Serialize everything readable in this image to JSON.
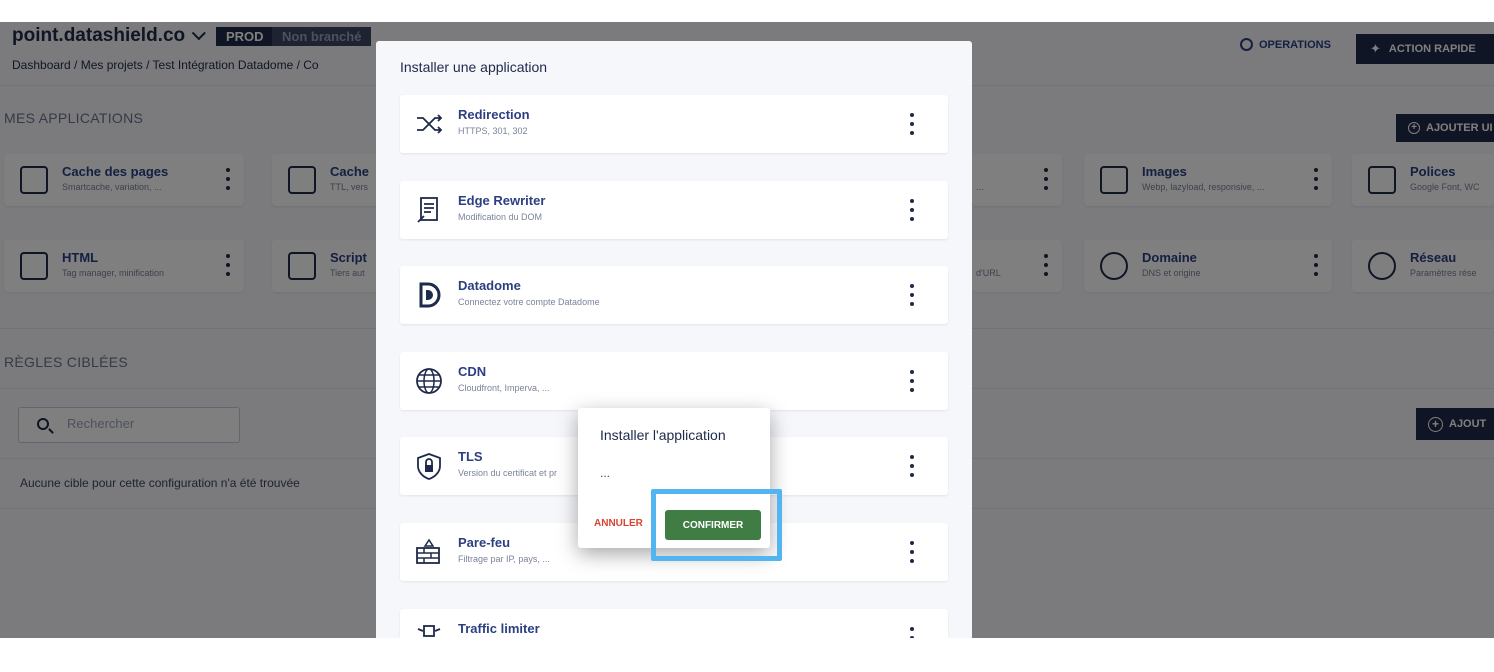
{
  "header": {
    "site": "point.datashield.co",
    "env_badge": "PROD",
    "branch_badge": "Non branché",
    "breadcrumb": "Dashboard / Mes projets / Test Intégration Datadome / Co",
    "operations_label": "OPERATIONS",
    "quick_action_label": "ACTION RAPIDE"
  },
  "apps_section": {
    "title": "MES APPLICATIONS",
    "add_label": "AJOUTER UI",
    "cards": [
      {
        "title": "Cache des pages",
        "subtitle": "Smartcache, variation, ...",
        "icon": "cloud-cache-icon"
      },
      {
        "title": "Cache",
        "subtitle": "TTL, vers",
        "icon": "cloud-cache-icon"
      },
      {
        "title": "Images",
        "subtitle": "Webp, lazyload, responsive, ...",
        "icon": "image-icon"
      },
      {
        "title": "Polices",
        "subtitle": "Google Font, WC",
        "icon": "font-icon"
      },
      {
        "title": "HTML",
        "subtitle": "Tag manager, minification",
        "icon": "html-icon"
      },
      {
        "title": "Script",
        "subtitle": "Tiers aut",
        "icon": "script-icon"
      },
      {
        "title": "Domaine",
        "subtitle": "DNS et origine",
        "icon": "www-icon"
      },
      {
        "title": "Réseau",
        "subtitle": "Paramètres rése",
        "icon": "network-icon"
      }
    ],
    "partial_text_1": "...",
    "partial_text_2": "d'URL"
  },
  "rules_section": {
    "title": "RÈGLES CIBLÉES",
    "search_placeholder": "Rechercher",
    "add_label": "AJOUT",
    "empty_text": "Aucune cible pour cette configuration n'a été trouvée"
  },
  "modal": {
    "title": "Installer une application",
    "items": [
      {
        "title": "Redirection",
        "subtitle": "HTTPS, 301, 302",
        "icon": "shuffle-icon"
      },
      {
        "title": "Edge Rewriter",
        "subtitle": "Modification du DOM",
        "icon": "document-edit-icon"
      },
      {
        "title": "Datadome",
        "subtitle": "Connectez votre compte Datadome",
        "icon": "datadome-logo-icon"
      },
      {
        "title": "CDN",
        "subtitle": "Cloudfront, Imperva, ...",
        "icon": "globe-icon"
      },
      {
        "title": "TLS",
        "subtitle": "Version du certificat et pr",
        "icon": "lock-shield-icon"
      },
      {
        "title": "Pare-feu",
        "subtitle": "Filtrage par IP, pays, ...",
        "icon": "firewall-icon"
      },
      {
        "title": "Traffic limiter",
        "subtitle": "",
        "icon": "traffic-limiter-icon"
      }
    ]
  },
  "confirm_dialog": {
    "title": "Installer l'application",
    "body": "...",
    "cancel_label": "ANNULER",
    "confirm_label": "CONFIRMER"
  }
}
